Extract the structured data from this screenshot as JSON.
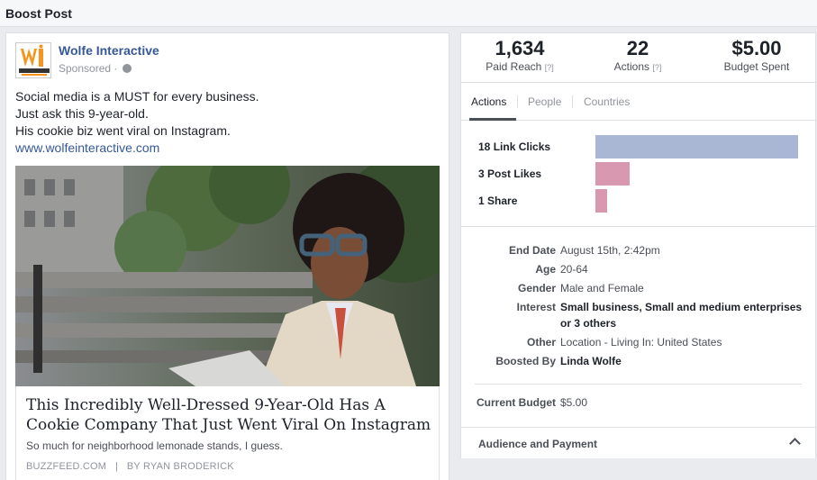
{
  "header": {
    "title": "Boost Post"
  },
  "post": {
    "page_name": "Wolfe Interactive",
    "sponsored": "Sponsored ·",
    "text_lines": [
      "Social media is a MUST for every business.",
      "Just ask this 9-year-old.",
      "His cookie biz went viral on Instagram."
    ],
    "link": "www.wolfeinteractive.com",
    "headline": "This Incredibly Well-Dressed 9-Year-Old Has A Cookie Company That Just Went Viral On Instagram",
    "subline": "So much for neighborhood lemonade stands, I guess.",
    "source": "BUZZFEED.COM",
    "author": "BY RYAN BRODERICK"
  },
  "stats": [
    {
      "value": "1,634",
      "label": "Paid Reach",
      "help": "[?]"
    },
    {
      "value": "22",
      "label": "Actions",
      "help": "[?]"
    },
    {
      "value": "$5.00",
      "label": "Budget Spent",
      "help": ""
    }
  ],
  "tabs": [
    {
      "label": "Actions",
      "active": true
    },
    {
      "label": "People",
      "active": false
    },
    {
      "label": "Countries",
      "active": false
    }
  ],
  "actions": [
    {
      "count": "18",
      "label": "Link Clicks",
      "value": 18,
      "color": "#a9b6d4"
    },
    {
      "count": "3",
      "label": "Post Likes",
      "value": 3,
      "color": "#d899b0"
    },
    {
      "count": "1",
      "label": "Share",
      "value": 1,
      "color": "#d899b0"
    }
  ],
  "details": {
    "end_date": {
      "label": "End Date",
      "value": "August 15th, 2:42pm"
    },
    "age": {
      "label": "Age",
      "value": "20-64"
    },
    "gender": {
      "label": "Gender",
      "value": "Male and Female"
    },
    "interest": {
      "label": "Interest",
      "value": "Small business, Small and medium enterprises or 3 others"
    },
    "other": {
      "label": "Other",
      "value": "Location - Living In: United States"
    },
    "boosted_by": {
      "label": "Boosted By",
      "value": "Linda Wolfe"
    }
  },
  "budget": {
    "label": "Current Budget",
    "value": "$5.00"
  },
  "accordion": {
    "label": "Audience and Payment"
  },
  "colors": {
    "link": "#365899",
    "accent_blue_bar": "#a9b6d4",
    "accent_pink_bar": "#d899b0"
  },
  "icons": {
    "globe": "globe-icon",
    "chevron": "chevron-up-icon",
    "logo": "wolfe-interactive-logo"
  }
}
